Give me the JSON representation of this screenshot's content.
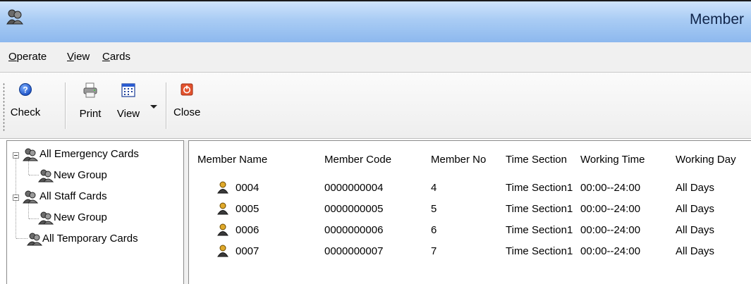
{
  "window": {
    "title": "Member"
  },
  "menu": [
    {
      "accel": "O",
      "rest": "perate"
    },
    {
      "accel": "V",
      "rest": "iew"
    },
    {
      "accel": "C",
      "rest": "ards"
    }
  ],
  "toolbar": {
    "check": "Check",
    "print": "Print",
    "view": "View",
    "close": "Close"
  },
  "tree": {
    "items": [
      {
        "label": "All Emergency Cards"
      },
      {
        "label": "New Group"
      },
      {
        "label": "All Staff Cards"
      },
      {
        "label": "New Group"
      },
      {
        "label": "All Temporary Cards"
      }
    ]
  },
  "grid": {
    "columns": [
      "Member Name",
      "Member Code",
      "Member No",
      "Time Section",
      "Working Time",
      "Working Day"
    ],
    "rows": [
      [
        "0004",
        "0000000004",
        "4",
        "Time Section1",
        "00:00--24:00",
        "All Days"
      ],
      [
        "0005",
        "0000000005",
        "5",
        "Time Section1",
        "00:00--24:00",
        "All Days"
      ],
      [
        "0006",
        "0000000006",
        "6",
        "Time Section1",
        "00:00--24:00",
        "All Days"
      ],
      [
        "0007",
        "0000000007",
        "7",
        "Time Section1",
        "00:00--24:00",
        "All Days"
      ]
    ]
  }
}
